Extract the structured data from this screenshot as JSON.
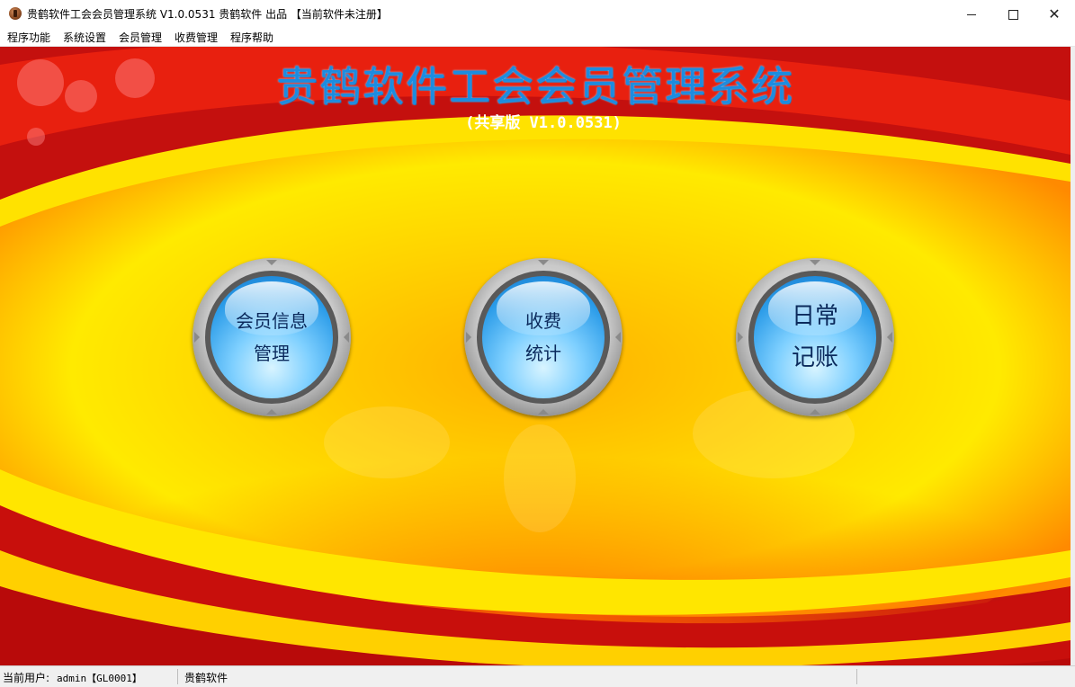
{
  "window": {
    "title": "贵鹤软件工会会员管理系统 V1.0.0531 贵鹤软件 出品 【当前软件未注册】",
    "icon": "app-logo-icon"
  },
  "controls": {
    "minimize_icon": "minimize-icon",
    "maximize_icon": "maximize-icon",
    "close_icon": "close-icon",
    "close_glyph": "✕"
  },
  "menu": {
    "items": [
      "程序功能",
      "系统设置",
      "会员管理",
      "收费管理",
      "程序帮助"
    ]
  },
  "main": {
    "title": "贵鹤软件工会会员管理系统",
    "version": "(共享版 V1.0.0531)",
    "buttons": [
      {
        "line1": "会员信息",
        "line2": "管理"
      },
      {
        "line1": "收费",
        "line2": "统计"
      },
      {
        "line1": "日常",
        "line2": "记账"
      }
    ]
  },
  "status": {
    "user_label": "当前用户:",
    "user_value": "admin【GL0001】",
    "company": "贵鹤软件"
  },
  "colors": {
    "title_blue": "#1c8ce0",
    "background_red": "#c4100e",
    "background_yellow": "#ffe800"
  }
}
